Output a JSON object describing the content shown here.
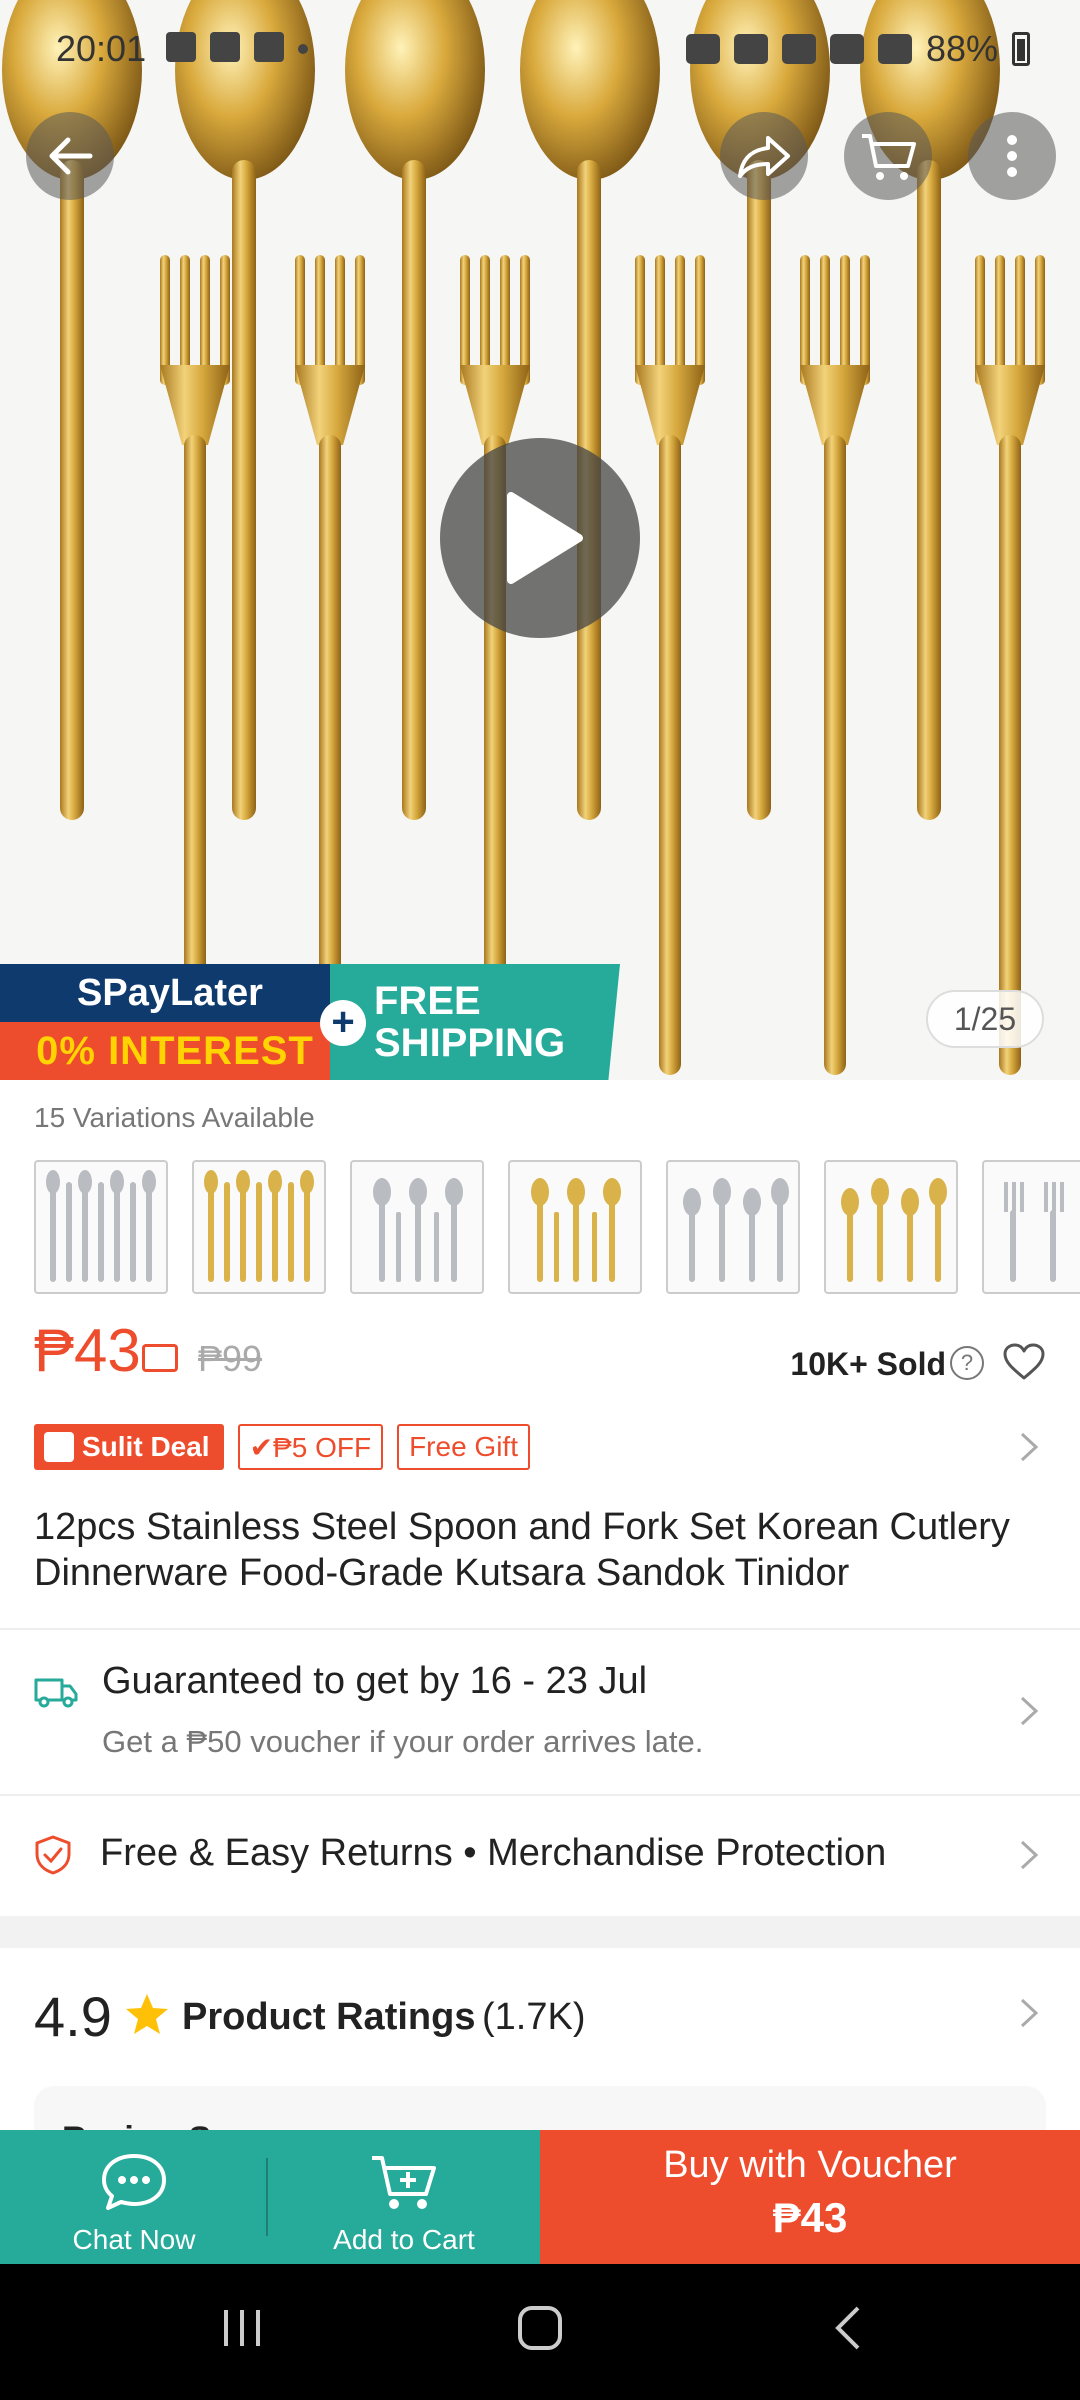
{
  "status_bar": {
    "time": "20:01",
    "battery": "88%"
  },
  "gallery": {
    "counter": "1/25",
    "promo": {
      "spaylater": "SPayLater",
      "interest": "0% INTEREST",
      "plus": "+",
      "free_shipping_line1": "FREE",
      "free_shipping_line2": "SHIPPING"
    }
  },
  "variations": {
    "label": "15 Variations Available",
    "thumbnails": [
      {
        "icon": "silver-set-thumb"
      },
      {
        "icon": "gold-set-thumb"
      },
      {
        "icon": "silver-spoon-fork-thumb"
      },
      {
        "icon": "gold-spoon-fork-thumb"
      },
      {
        "icon": "silver-spoons-thumb"
      },
      {
        "icon": "gold-spoons-thumb"
      },
      {
        "icon": "silver-forks-thumb"
      }
    ]
  },
  "price": {
    "current": "₱43",
    "original": "₱99",
    "sold": "10K+ Sold",
    "help": "?"
  },
  "badges": {
    "sulit": "Sulit Deal",
    "off": "✔₱5 OFF",
    "gift": "Free Gift"
  },
  "product": {
    "title": "12pcs Stainless Steel Spoon and Fork Set Korean Cutlery Dinnerware Food-Grade Kutsara Sandok Tinidor"
  },
  "shipping": {
    "title": "Guaranteed to get by 16 - 23 Jul",
    "subtitle": "Get a ₱50 voucher if your order arrives late."
  },
  "returns": {
    "text": "Free & Easy Returns  •  Merchandise Protection"
  },
  "ratings": {
    "score": "4.9",
    "label": "Product Ratings",
    "count": "(1.7K)"
  },
  "review_card": {
    "partial_text": "Review Summary"
  },
  "bottom_bar": {
    "chat": "Chat Now",
    "cart": "Add to Cart",
    "buy": "Buy with Voucher",
    "buy_price": "₱43"
  },
  "colors": {
    "brand_orange": "#ee4d2d",
    "teal": "#26aa99",
    "navy": "#0f3a6e",
    "gold": "#d9b24a"
  }
}
